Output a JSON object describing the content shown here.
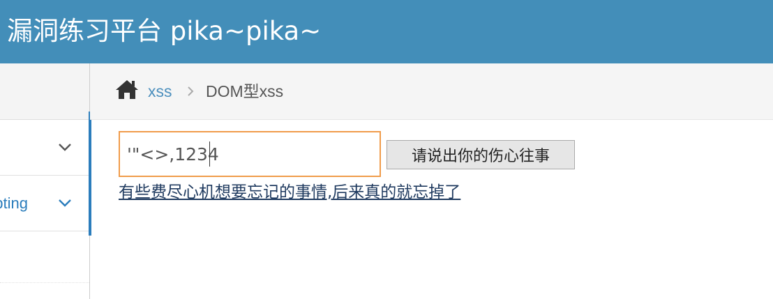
{
  "header": {
    "title": "漏洞练习平台 pika~pika~"
  },
  "sidebar": {
    "items": [
      {
        "label": "",
        "icon": "chevron-down-icon"
      },
      {
        "label": "Cross-Site Scripting",
        "icon": "chevron-down-icon"
      }
    ]
  },
  "breadcrumb": {
    "home_icon": "home-icon",
    "link_label": "xss",
    "current_label": "DOM型xss"
  },
  "form": {
    "input_value": "'\"<>,1234",
    "submit_label": "请说出你的伤心往事"
  },
  "result": {
    "link_text": "有些费尽心机想要忘记的事情,后来真的就忘掉了"
  },
  "colors": {
    "header_bg": "#438eb9",
    "accent_blue": "#2b7dbc",
    "input_focus_border": "#f09b4a"
  }
}
